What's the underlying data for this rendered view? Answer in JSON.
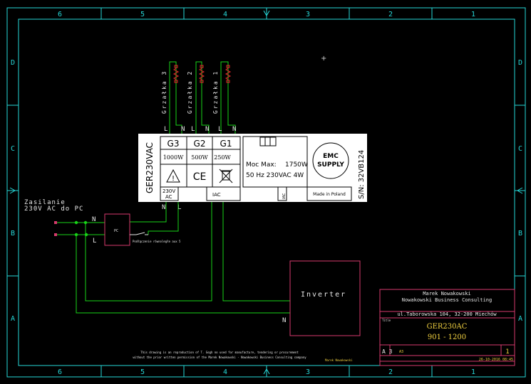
{
  "frame": {
    "col_labels": [
      "6",
      "5",
      "4",
      "3",
      "2",
      "1"
    ],
    "row_labels": [
      "D",
      "C",
      "B",
      "A"
    ],
    "colors": {
      "frame": "#26d7d7",
      "wire": "#18d418",
      "component": "#d83a6e",
      "text": "#e8e8e8",
      "resistor": "#e8242a",
      "titlebox_text": "#f0d040"
    }
  },
  "heaters": [
    {
      "label": "Grzałka 3",
      "number": "3"
    },
    {
      "label": "Grzałka 2",
      "number": "2"
    },
    {
      "label": "Grzałka 1",
      "number": "1"
    }
  ],
  "terminal_labels": [
    "L",
    "N",
    "L",
    "N",
    "L",
    "N"
  ],
  "nameplate": {
    "model": "GER230VAC",
    "columns": [
      {
        "name": "G3",
        "power": "1000W"
      },
      {
        "name": "G2",
        "power": "500W"
      },
      {
        "name": "G1",
        "power": "250W"
      }
    ],
    "power_label": "Moc Max:",
    "power_value": "1750W",
    "supply_line": "50 Hz  230VAC   4W",
    "emc_line1": "EMC",
    "emc_line2": "SUPPLY",
    "ce_mark": "CE",
    "warning_mark": "!",
    "made_in": "Made in Poland",
    "serial": "S/N:  32VB124",
    "input_label_1": "230V",
    "input_label_2": "AC",
    "iac_label": "IAC",
    "small_vertical": "IAC"
  },
  "input_terminals": [
    "N",
    "L"
  ],
  "supply": {
    "line1": "Zasilanie",
    "line2": "230V AC do PC"
  },
  "supply_wires": [
    "N",
    "L"
  ],
  "pc": {
    "label": "PC",
    "wire_note": "Podłączenie równoległe aux 5"
  },
  "inverter": {
    "label": "Inverter",
    "terminal": "N"
  },
  "title_block": {
    "author": "Marek Nowakowski",
    "company": "Nowakowski Business Consulting",
    "address": "ul.Taborowska 104, 32-200 Miechów",
    "file_label": "Title",
    "title_line1": "GER230AC",
    "title_line2": "901 - 1200",
    "size_label": "A 3",
    "rev_label": "A3",
    "sheet_number": "1",
    "date": "26-10-2016  08:45",
    "bottom_left": "Marek Nowakowski"
  },
  "copyright_line1": "This drawing is an reproduction of T. Gogh no used for manufacture, tendering or procurement",
  "copyright_line2": "without the prior written permission of the Marek Nowakowski - Nowakowski Business Consulting company"
}
